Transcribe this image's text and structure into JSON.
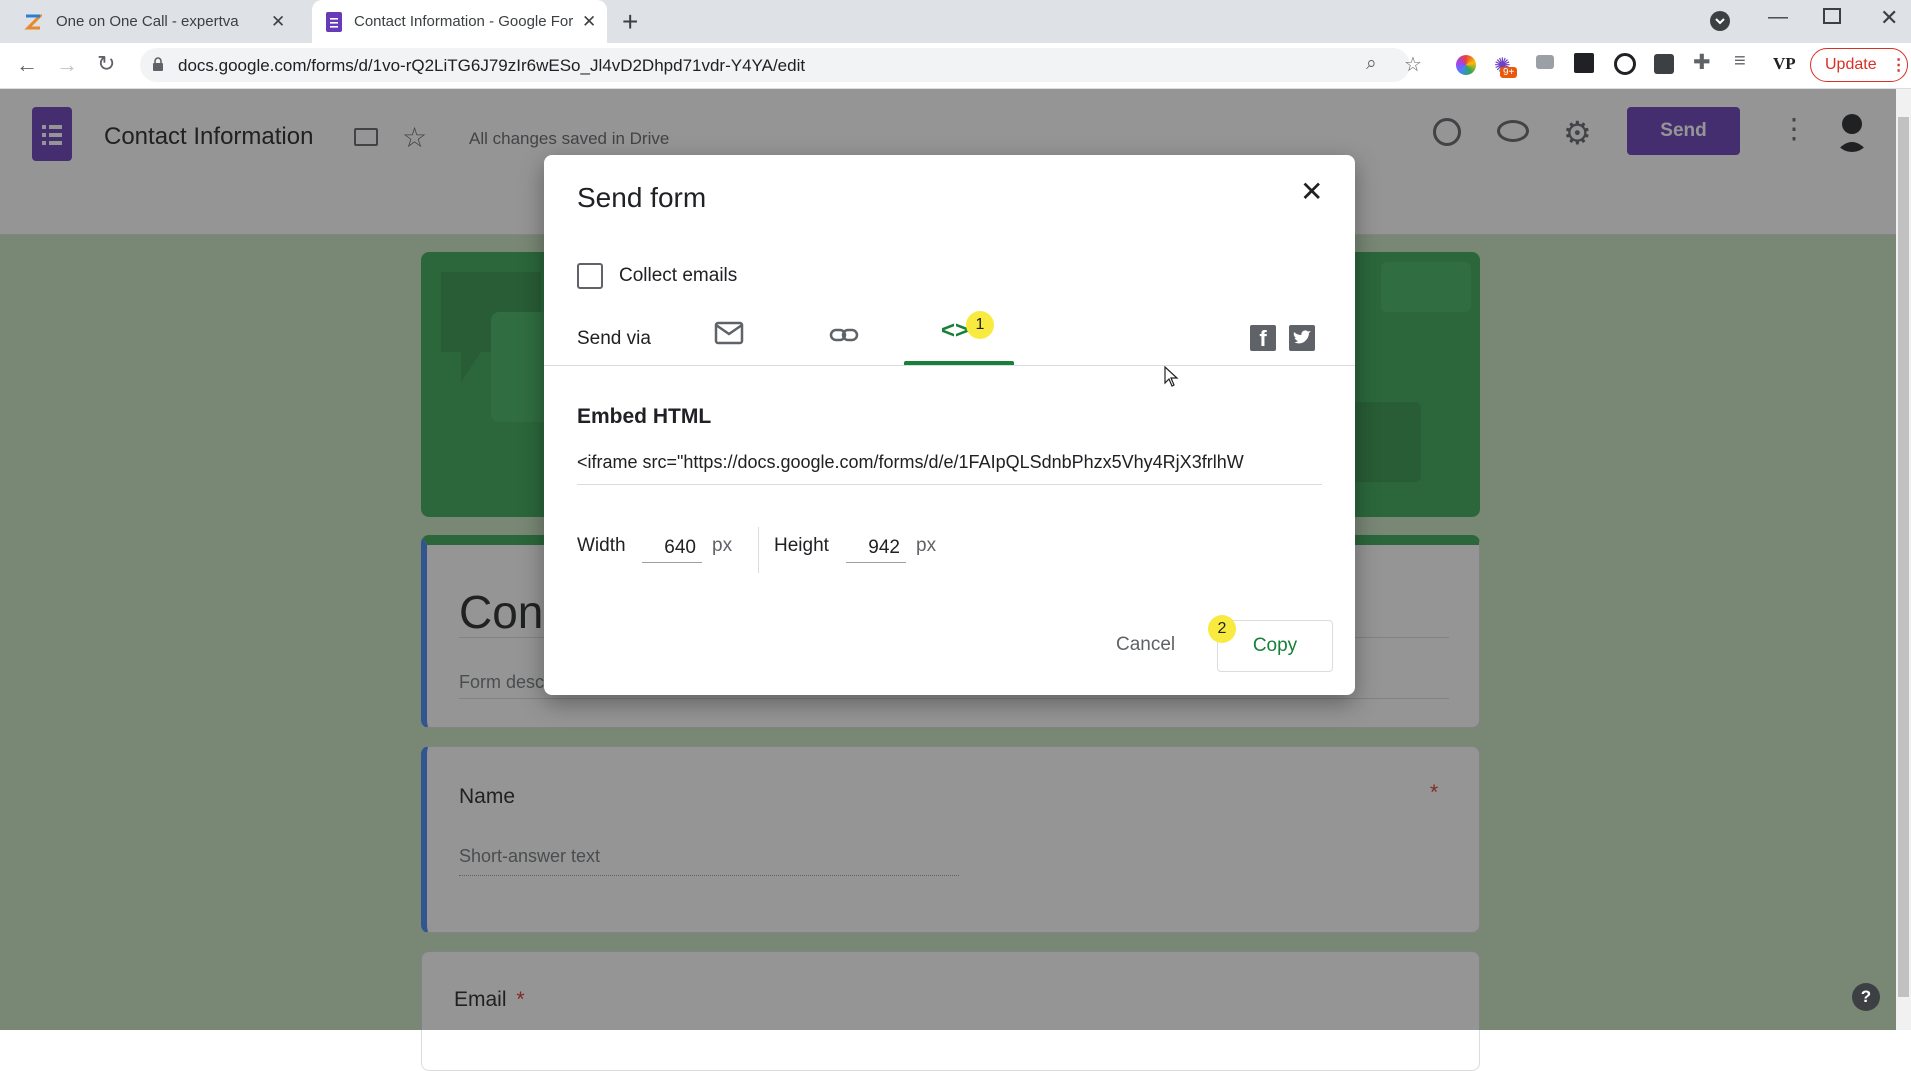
{
  "browser": {
    "tabs": [
      {
        "title": "One on One Call - expertva",
        "favicon": "zoho-icon"
      },
      {
        "title": "Contact Information - Google Forms",
        "favicon": "google-forms-icon"
      }
    ],
    "new_tab": "+",
    "url": "docs.google.com/forms/d/1vo-rQ2LiTG6J79zIr6wESo_Jl4vD2Dhpd71vdr-Y4YA/edit",
    "profile_initials": "VP",
    "update_label": "Update",
    "extension_badge": "9+"
  },
  "forms_header": {
    "doc_title": "Contact Information",
    "save_status": "All changes saved in Drive",
    "send_label": "Send",
    "brand_color": "#673ab7"
  },
  "form": {
    "title": "Cont",
    "description_placeholder": "Form desc",
    "questions": [
      {
        "label": "Name",
        "placeholder": "Short-answer text",
        "required_mark": "*"
      },
      {
        "label": "Email",
        "required_mark": "*"
      }
    ],
    "help_icon": "?"
  },
  "dialog": {
    "title": "Send form",
    "collect_emails_label": "Collect emails",
    "collect_emails_checked": false,
    "send_via_label": "Send via",
    "active_tab": "embed",
    "accent_color": "#188038",
    "tab_badge": "1",
    "embed_heading": "Embed HTML",
    "embed_code": "<iframe src=\"https://docs.google.com/forms/d/e/1FAIpQLSdnbPhzx5Vhy4RjX3frlhW",
    "width_label": "Width",
    "width_value": "640",
    "height_label": "Height",
    "height_value": "942",
    "px_unit": "px",
    "cancel_label": "Cancel",
    "copy_label": "Copy",
    "copy_badge": "2"
  }
}
